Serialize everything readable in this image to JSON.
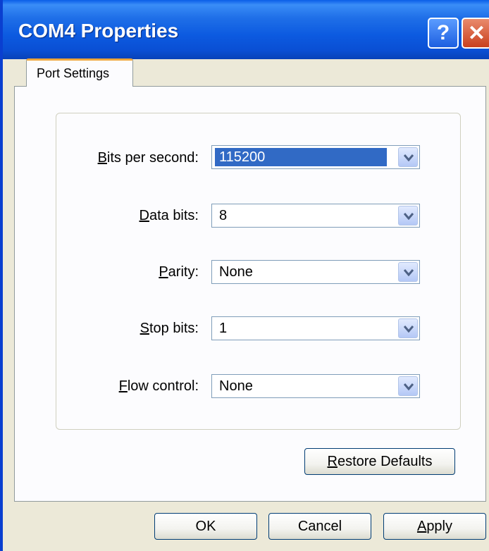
{
  "window": {
    "title": "COM4 Properties",
    "help_glyph": "?",
    "close_glyph": "✕"
  },
  "tabs": [
    {
      "label": "Port Settings",
      "active": true
    }
  ],
  "settings": {
    "bits_per_second": {
      "label_key": "B",
      "label_rest": "its per second:",
      "value": "115200"
    },
    "data_bits": {
      "label_key": "D",
      "label_rest": "ata bits:",
      "value": "8"
    },
    "parity": {
      "label_key": "P",
      "label_rest": "arity:",
      "value": "None"
    },
    "stop_bits": {
      "label_key": "S",
      "label_rest": "top bits:",
      "value": "1"
    },
    "flow_control": {
      "label_key": "F",
      "label_rest": "low control:",
      "value": "None"
    }
  },
  "buttons": {
    "restore_key": "R",
    "restore_rest": "estore Defaults",
    "ok": "OK",
    "cancel": "Cancel",
    "apply_key": "A",
    "apply_rest": "pply"
  },
  "colors": {
    "titlebar": "#0a5ee8",
    "selection": "#316ac5",
    "tab_highlight": "#f0a63a",
    "close_button": "#c9401e"
  },
  "icons": {
    "help": "question-mark-icon",
    "close": "close-x-icon",
    "dropdown": "chevron-down-icon"
  }
}
